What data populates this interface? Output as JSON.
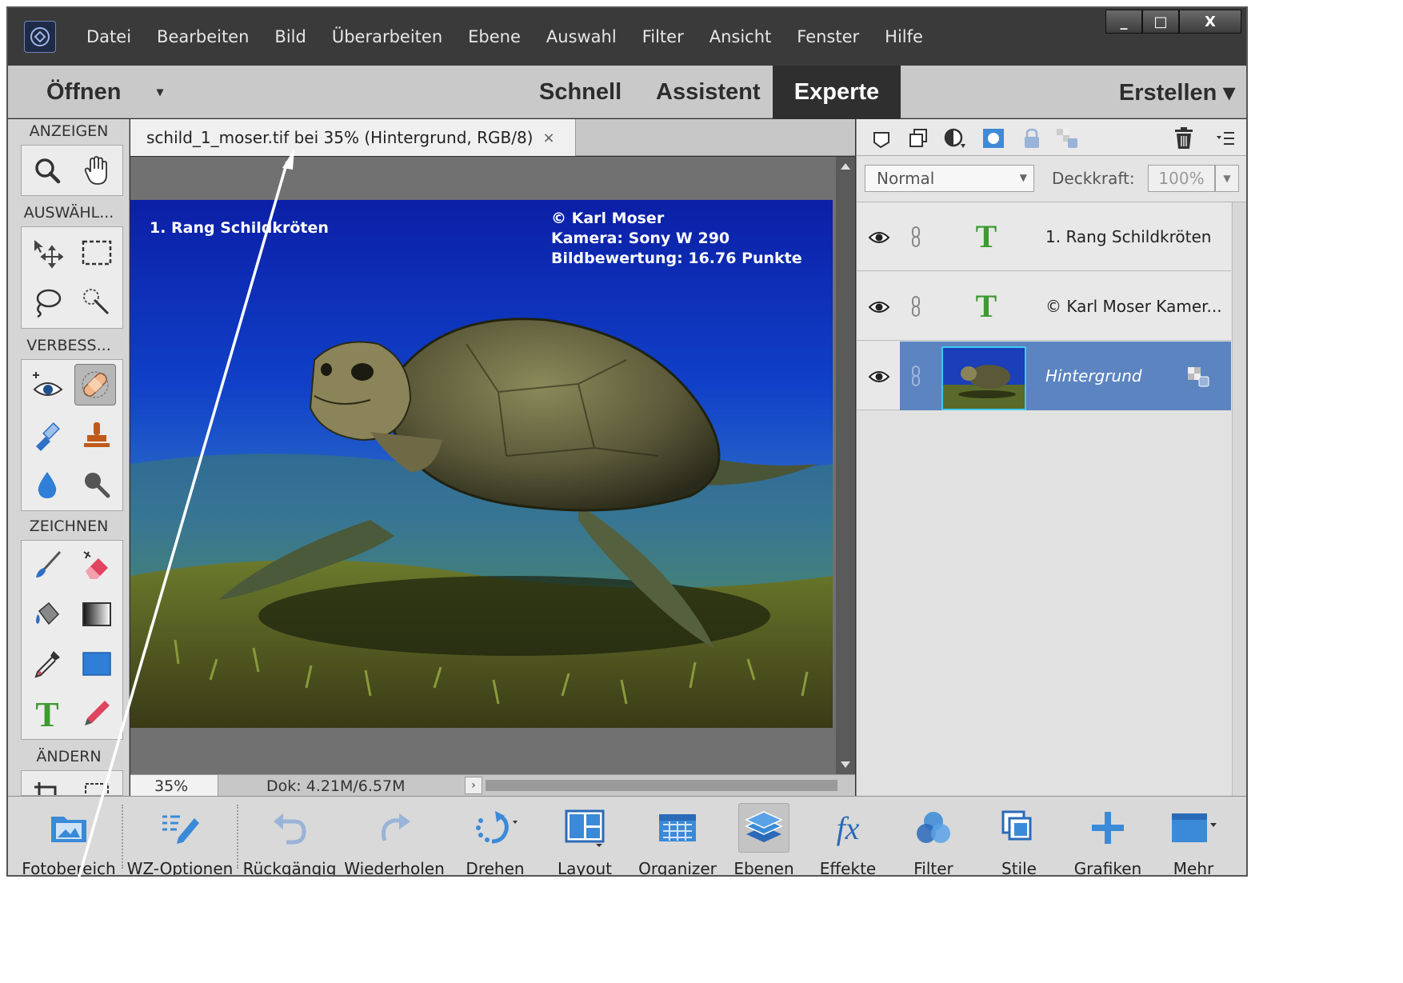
{
  "menu": {
    "items": [
      "Datei",
      "Bearbeiten",
      "Bild",
      "Überarbeiten",
      "Ebene",
      "Auswahl",
      "Filter",
      "Ansicht",
      "Fenster",
      "Hilfe"
    ]
  },
  "window_controls": {
    "minimize": "_",
    "maximize": "□",
    "close": "X"
  },
  "modes": {
    "open": "Öffnen",
    "open_caret": "▾",
    "quick": "Schnell",
    "guided": "Assistent",
    "expert": "Experte",
    "create": "Erstellen ▾",
    "active": "Experte"
  },
  "toolbox": {
    "sections": [
      "ANZEIGEN",
      "AUSWÄHL...",
      "VERBESS...",
      "ZEICHNEN",
      "ÄNDERN"
    ],
    "tools": {
      "view": [
        "zoom-icon",
        "hand-icon"
      ],
      "select": [
        "move-icon",
        "marquee-icon",
        "lasso-icon",
        "quick-selection-icon"
      ],
      "enhance": [
        "red-eye-icon",
        "spot-healing-icon",
        "smart-brush-icon",
        "clone-stamp-icon",
        "blur-icon",
        "sponge-icon"
      ],
      "draw": [
        "brush-icon",
        "eraser-icon",
        "paint-bucket-icon",
        "gradient-icon",
        "eyedropper-icon",
        "shape-icon",
        "text-icon",
        "pencil-icon"
      ],
      "modify": [
        "crop-icon",
        "recompose-icon"
      ]
    },
    "active_tool": "spot-healing-icon"
  },
  "document": {
    "tab_title": "schild_1_moser.tif bei 35% (Hintergrund, RGB/8)",
    "tab_close": "×",
    "zoom": "35%",
    "doc_size": "Dok: 4.21M/6.57M",
    "status_arrow": "›"
  },
  "image_overlay": {
    "title": "1. Rang Schildkröten",
    "line1": "© Karl Moser",
    "line2": "Kamera: Sony W 290",
    "line3": "Bildbewertung: 16.76 Punkte"
  },
  "layers_panel": {
    "toolbar_icons": [
      "new-layer-icon",
      "new-group-icon",
      "adjustment-layer-icon",
      "layer-mask-icon",
      "lock-all-icon",
      "lock-transparency-icon",
      "delete-layer-icon",
      "panel-menu-icon"
    ],
    "blend_mode": "Normal",
    "opacity_label": "Deckkraft:",
    "opacity_value": "100%",
    "layers": [
      {
        "name": "1. Rang Schildkröten",
        "kind": "text",
        "selected": false
      },
      {
        "name": "© Karl Moser Kamer...",
        "kind": "text",
        "selected": false
      },
      {
        "name": "Hintergrund",
        "kind": "image",
        "selected": true
      }
    ]
  },
  "taskbar": {
    "buttons": [
      "Fotobereich",
      "WZ-Optionen",
      "Rückgängig",
      "Wiederholen",
      "Drehen",
      "Layout",
      "Organizer",
      "Ebenen",
      "Effekte",
      "Filter",
      "Stile",
      "Grafiken",
      "Mehr"
    ],
    "active": "Ebenen"
  },
  "colors": {
    "expert_tab_bg": "#2f2f2f",
    "selected_layer": "#5b84c0",
    "text_layer_icon": "#3f9a33",
    "accent_blue": "#2f6fc4"
  }
}
